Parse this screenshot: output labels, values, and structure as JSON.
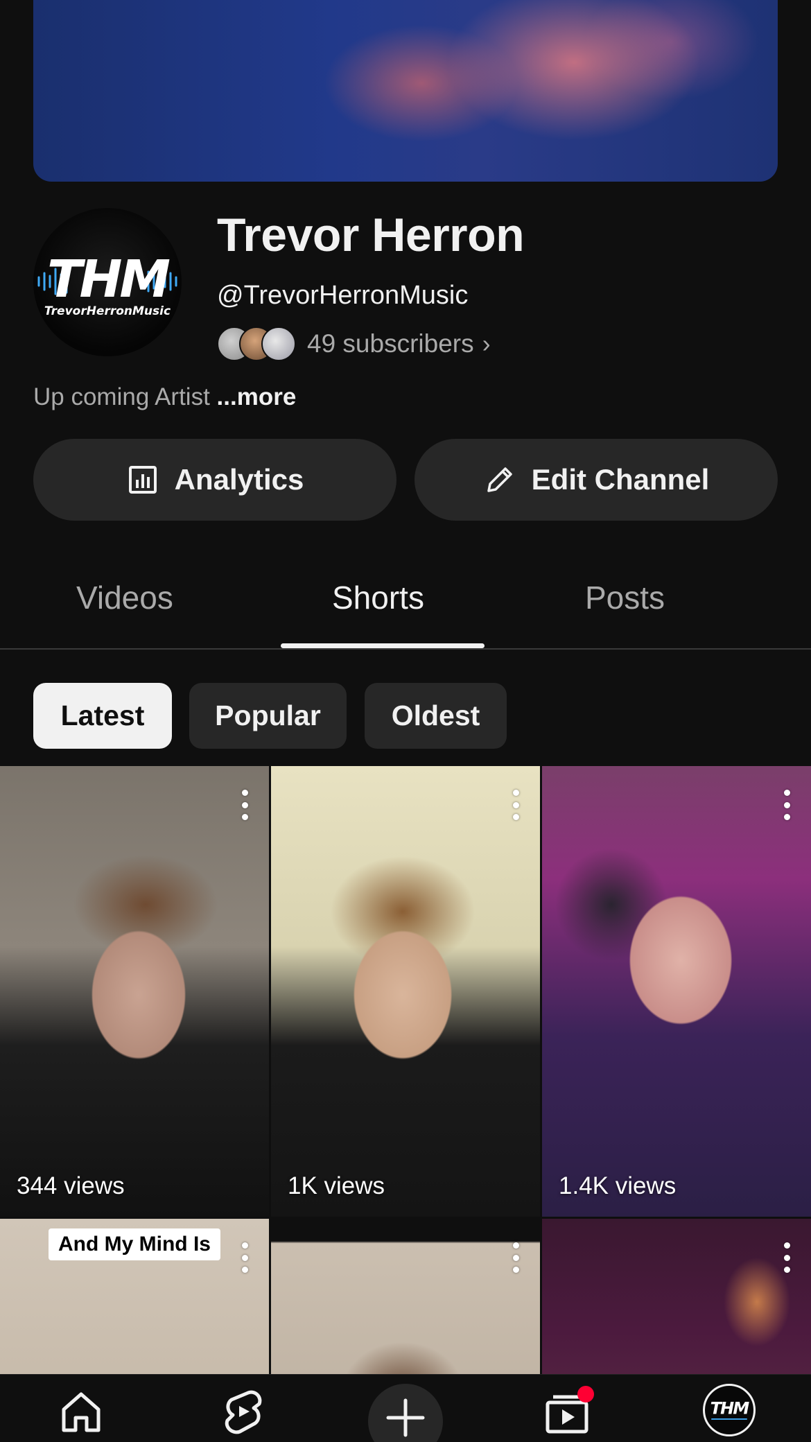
{
  "channel": {
    "name": "Trevor Herron",
    "handle": "@TrevorHerronMusic",
    "subscribers": "49 subscribers",
    "description": "Up coming Artist",
    "more_label": "...more",
    "avatar_logo_text": "THM",
    "avatar_logo_subtext": "TrevorHerronMusic"
  },
  "actions": {
    "analytics_label": "Analytics",
    "edit_label": "Edit Channel"
  },
  "tabs": [
    {
      "label": "Videos",
      "active": false
    },
    {
      "label": "Shorts",
      "active": true
    },
    {
      "label": "Posts",
      "active": false
    }
  ],
  "chips": [
    {
      "label": "Latest",
      "active": true
    },
    {
      "label": "Popular",
      "active": false
    },
    {
      "label": "Oldest",
      "active": false
    }
  ],
  "shorts": [
    {
      "views": "344 views"
    },
    {
      "views": "1K views"
    },
    {
      "views": "1.4K views"
    },
    {
      "views": "",
      "caption": "And My Mind Is"
    },
    {
      "views": ""
    },
    {
      "views": ""
    }
  ],
  "bottom_nav": {
    "items": [
      "home-icon",
      "shorts-icon",
      "create-icon",
      "subscriptions-icon",
      "you-avatar"
    ],
    "notification_color": "#ff0033"
  },
  "colors": {
    "background": "#0f0f0f",
    "surface": "#272727",
    "text_primary": "#f1f1f1",
    "text_secondary": "#aaaaaa",
    "logo_accent": "#3fa9f5"
  }
}
